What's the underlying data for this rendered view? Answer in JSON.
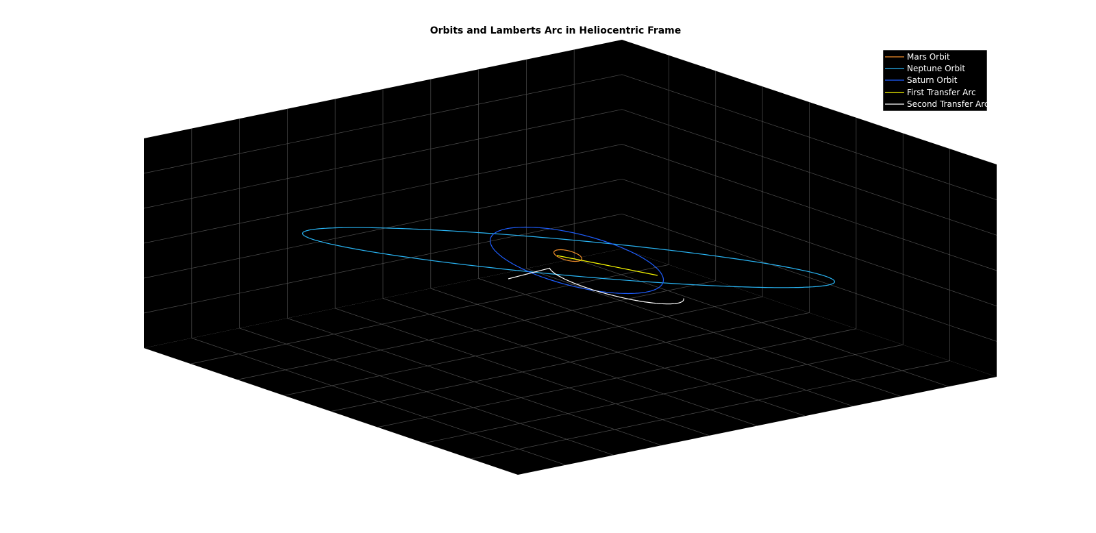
{
  "chart_data": {
    "type": "line",
    "projection": "3d",
    "title": "Orbits and Lamberts Arc in Heliocentric Frame",
    "grid": true,
    "background": "#000000",
    "grid_color": "#4d4d4d",
    "legend_position": "top-right",
    "series": [
      {
        "name": "Mars Orbit",
        "color": "#f28e2b",
        "kind": "closed-ellipse"
      },
      {
        "name": "Neptune Orbit",
        "color": "#29b6f6",
        "kind": "closed-ellipse"
      },
      {
        "name": "Saturn Orbit",
        "color": "#1e5eff",
        "kind": "closed-ellipse"
      },
      {
        "name": "First Transfer Arc",
        "color": "#ffff00",
        "kind": "arc"
      },
      {
        "name": "Second Transfer Arc",
        "color": "#ffffff",
        "kind": "arc"
      }
    ]
  }
}
